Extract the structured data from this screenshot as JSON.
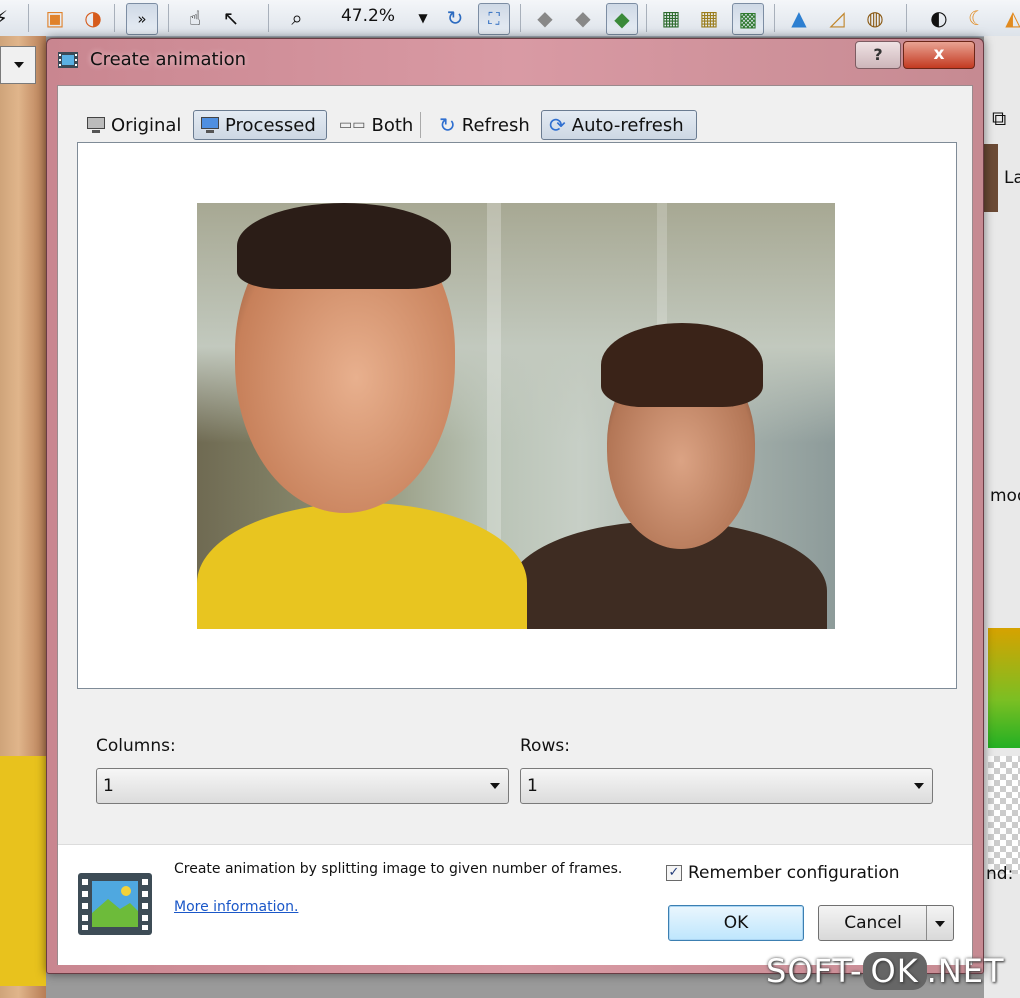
{
  "app": {
    "zoom": "47.2%"
  },
  "background_panel": {
    "text_la": "La",
    "text_mod": "mod",
    "text_nd": "nd:"
  },
  "dialog": {
    "title": "Create animation",
    "help_label": "?",
    "close_label": "x",
    "view_toolbar": {
      "original": "Original",
      "processed": "Processed",
      "both": "Both",
      "refresh": "Refresh",
      "auto_refresh": "Auto-refresh",
      "active": "processed"
    },
    "columns_label": "Columns:",
    "columns_value": "1",
    "rows_label": "Rows:",
    "rows_value": "1",
    "info_text": "Create animation by splitting image to given number of frames.",
    "more_info": "More information.",
    "remember_label": "Remember configuration",
    "remember_checked": true,
    "ok": "OK",
    "cancel": "Cancel"
  },
  "watermark": {
    "part1": "SOFT-",
    "part2": "OK",
    "part3": ".NET"
  },
  "colors": {
    "title_bar": "#d99aa4",
    "close_button": "#c33a21",
    "link": "#1a57c8"
  }
}
